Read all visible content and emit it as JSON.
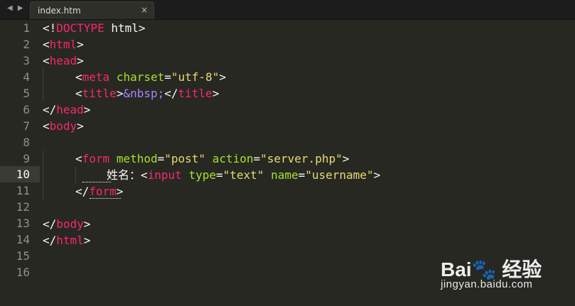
{
  "tabbar": {
    "nav_arrows": "◀ ▶",
    "tab": {
      "title": "index.htm",
      "close": "×"
    }
  },
  "editor": {
    "line_numbers": [
      "1",
      "2",
      "3",
      "4",
      "5",
      "6",
      "7",
      "8",
      "9",
      "10",
      "11",
      "12",
      "13",
      "14",
      "15",
      "16"
    ],
    "active_line": "10",
    "lines": {
      "l1": {
        "a": "<!",
        "b": "DOCTYPE",
        "c": " html>"
      },
      "l2": {
        "a": "<",
        "b": "html",
        "c": ">"
      },
      "l3": {
        "a": "<",
        "b": "head",
        "c": ">"
      },
      "l4": {
        "a": "<",
        "b": "meta",
        "c": " ",
        "d": "charset",
        "e": "=",
        "f": "\"utf-8\"",
        "g": ">"
      },
      "l5": {
        "a": "<",
        "b": "title",
        "c": ">",
        "d": "&nbsp;",
        "e": "</",
        "f": "title",
        "g": ">"
      },
      "l6": {
        "a": "</",
        "b": "head",
        "c": ">"
      },
      "l7": {
        "a": "<",
        "b": "body",
        "c": ">"
      },
      "l9": {
        "a": "<",
        "b": "form",
        "c": " ",
        "d": "method",
        "e": "=",
        "f": "\"post\"",
        "g": " ",
        "h": "action",
        "i": "=",
        "j": "\"server.php\"",
        "k": ">"
      },
      "l10": {
        "a": "姓名：<",
        "b": "input",
        "c": " ",
        "d": "type",
        "e": "=",
        "f": "\"text\"",
        "g": " ",
        "h": "name",
        "i": "=",
        "j": "\"username\"",
        "k": ">"
      },
      "l11": {
        "a": "</",
        "b": "form",
        "c": ">"
      },
      "l13": {
        "a": "</",
        "b": "body",
        "c": ">"
      },
      "l14": {
        "a": "</",
        "b": "html",
        "c": ">"
      }
    }
  },
  "watermark": {
    "logo_text": "Bai🐾 经验",
    "url": "jingyan.baidu.com"
  }
}
